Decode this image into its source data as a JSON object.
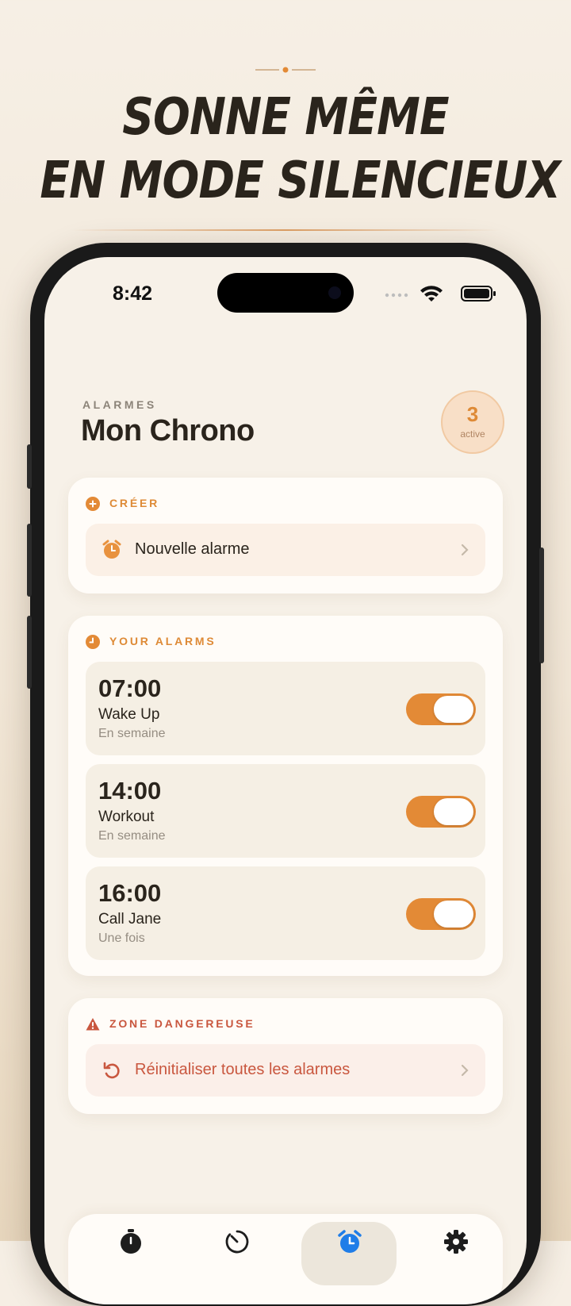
{
  "headline": {
    "line1": "SONNE MÊME",
    "line2": "EN MODE SILENCIEUX"
  },
  "status_bar": {
    "time": "8:42"
  },
  "header": {
    "section_label": "ALARMES",
    "title": "Mon Chrono",
    "badge_count": "3",
    "badge_label": "active"
  },
  "create_card": {
    "title": "CRÉER",
    "new_alarm_label": "Nouvelle alarme"
  },
  "alarms_card": {
    "title": "YOUR ALARMS",
    "alarms": [
      {
        "time": "07:00",
        "name": "Wake Up",
        "repeat": "En semaine",
        "enabled": true
      },
      {
        "time": "14:00",
        "name": "Workout",
        "repeat": "En semaine",
        "enabled": true
      },
      {
        "time": "16:00",
        "name": "Call Jane",
        "repeat": "Une fois",
        "enabled": true
      }
    ]
  },
  "danger_card": {
    "title": "ZONE DANGEREUSE",
    "reset_label": "Réinitialiser toutes les alarmes"
  },
  "tab_bar": {
    "active_tab": "alarm",
    "tabs": [
      "stopwatch-icon",
      "timer-icon",
      "alarm-icon",
      "gear-icon"
    ]
  },
  "colors": {
    "accent": "#e38a36",
    "danger": "#c9573f",
    "background": "#f7f1e8",
    "card": "#fffcf8"
  }
}
